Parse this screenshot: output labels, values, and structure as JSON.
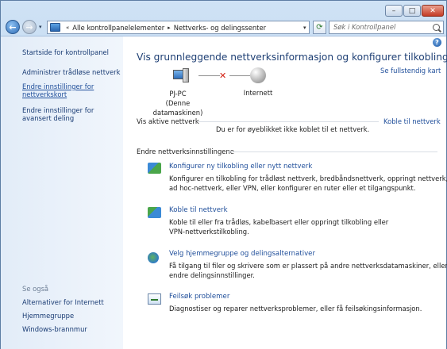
{
  "navigation": {
    "breadcrumb_arrows": "«",
    "breadcrumb": [
      "Alle kontrollpanelelementer",
      "Nettverks- og delingssenter"
    ],
    "search_placeholder": "Søk i Kontrollpanel"
  },
  "sidebar": {
    "items": [
      {
        "label": "Startside for kontrollpanel"
      },
      {
        "label": "Administrer trådløse nettverk"
      },
      {
        "label": "Endre innstillinger for nettverkskort"
      },
      {
        "label": "Endre innstillinger for avansert deling"
      }
    ],
    "see_also_label": "Se også",
    "see_also": [
      {
        "label": "Alternativer for Internett"
      },
      {
        "label": "Hjemmegruppe"
      },
      {
        "label": "Windows-brannmur"
      }
    ]
  },
  "main": {
    "heading": "Vis grunnleggende nettverksinformasjon og konfigurer tilkoblinger",
    "full_map_link": "Se fullstendig kart",
    "network_map": {
      "computer_name": "PJ-PC",
      "computer_caption": "(Denne datamaskinen)",
      "internet_label": "Internett"
    },
    "active_networks_label": "Vis aktive nettverk",
    "connect_link": "Koble til nettverk",
    "active_networks_message": "Du er for øyeblikket ikke koblet til et nettverk.",
    "settings_label": "Endre nettverksinnstillingene",
    "tasks": [
      {
        "icon": "new-connection-icon",
        "title": "Konfigurer ny tilkobling eller nytt nettverk",
        "desc": [
          "Konfigurer en tilkobling for trådløst nettverk, bredbåndsnettverk, oppringt nettverk,",
          "ad hoc-nettverk, eller VPN, eller konfigurer en ruter eller et tilgangspunkt."
        ]
      },
      {
        "icon": "connect-network-icon",
        "title": "Koble til nettverk",
        "desc": [
          "Koble til eller fra trådløs, kabelbasert eller oppringt tilkobling eller",
          "VPN-nettverkstilkobling."
        ]
      },
      {
        "icon": "homegroup-icon",
        "title": "Velg hjemmegruppe og delingsalternativer",
        "desc": [
          "Få tilgang til filer og skrivere som er plassert på andre nettverksdatamaskiner, eller",
          "endre delingsinnstillinger."
        ]
      },
      {
        "icon": "troubleshoot-icon",
        "title": "Feilsøk problemer",
        "desc": [
          "Diagnostiser og reparer nettverksproblemer, eller få feilsøkingsinformasjon."
        ]
      }
    ]
  }
}
